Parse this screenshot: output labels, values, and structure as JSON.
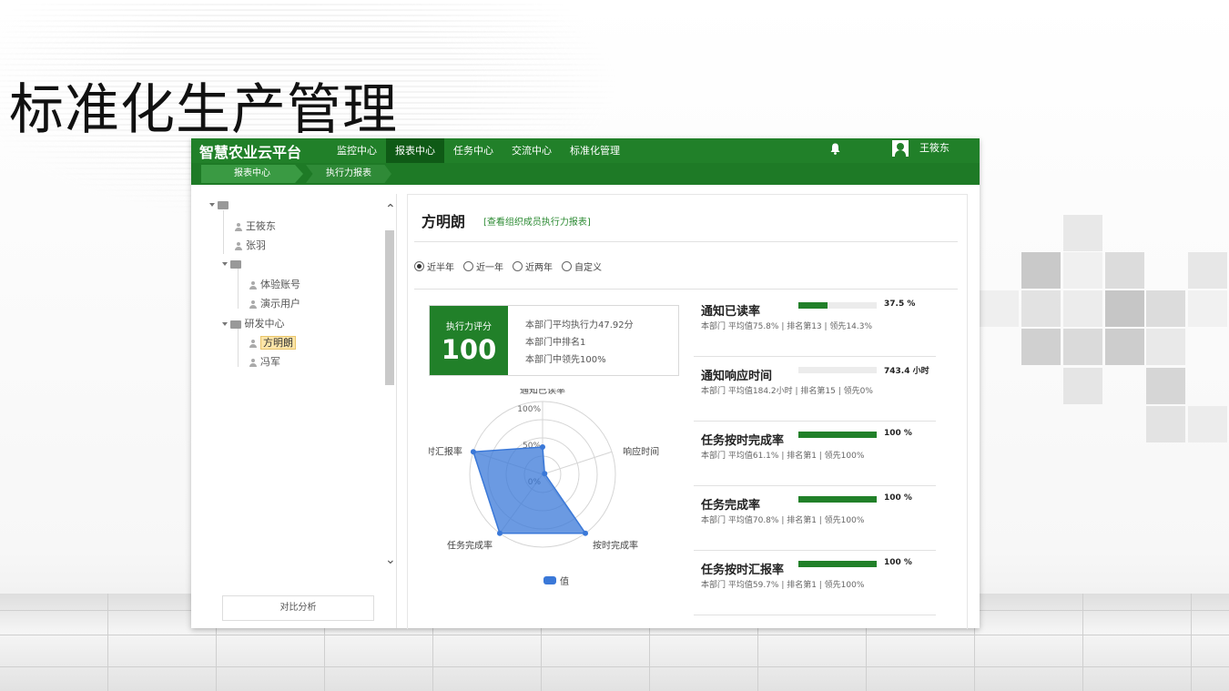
{
  "page_title": "标准化生产管理",
  "app": {
    "logo": "智慧农业云平台",
    "nav": [
      "监控中心",
      "报表中心",
      "任务中心",
      "交流中心",
      "标准化管理"
    ],
    "active_nav": "报表中心",
    "user_name": "王筱东",
    "icons": {
      "notifications": "bell-icon",
      "user": "user-avatar-icon"
    }
  },
  "breadcrumb": [
    "报表中心",
    "执行力报表"
  ],
  "tree": {
    "nodes": [
      {
        "label": "",
        "type": "folder",
        "expanded": true
      },
      {
        "label": "王筱东",
        "type": "person"
      },
      {
        "label": "张羽",
        "type": "person"
      },
      {
        "label": "",
        "type": "folder",
        "expanded": true
      },
      {
        "label": "体验账号",
        "type": "person"
      },
      {
        "label": "演示用户",
        "type": "person"
      },
      {
        "label": "研发中心",
        "type": "folder",
        "expanded": true
      },
      {
        "label": "方明朗",
        "type": "person",
        "selected": true
      },
      {
        "label": "冯军",
        "type": "person"
      }
    ],
    "compare_button": "对比分析"
  },
  "main": {
    "person_name": "方明朗",
    "view_link": "[查看组织成员执行力报表]",
    "periods": [
      "近半年",
      "近一年",
      "近两年",
      "自定义"
    ],
    "selected_period": "近半年",
    "score": {
      "label": "执行力评分",
      "value": "100",
      "lines": [
        "本部门平均执行力47.92分",
        "本部门中排名1",
        "本部门中领先100%"
      ]
    },
    "radar": {
      "axes": [
        "通知已读率",
        "响应时间",
        "按时完成率",
        "任务完成率",
        "按时汇报率"
      ],
      "ring_labels": [
        "100%",
        "50%",
        "0%"
      ],
      "legend": "值"
    },
    "metrics": [
      {
        "name": "通知已读率",
        "value": "37.5 %",
        "sub": "本部门 平均值75.8% | 排名第13 | 领先14.3%"
      },
      {
        "name": "通知响应时间",
        "value": "743.4 小时",
        "sub": "本部门 平均值184.2小时 | 排名第15 | 领先0%"
      },
      {
        "name": "任务按时完成率",
        "value": "100 %",
        "sub": "本部门 平均值61.1% | 排名第1 | 领先100%"
      },
      {
        "name": "任务完成率",
        "value": "100 %",
        "sub": "本部门 平均值70.8% | 排名第1 | 领先100%"
      },
      {
        "name": "任务按时汇报率",
        "value": "100 %",
        "sub": "本部门 平均值59.7% | 排名第1 | 领先100%"
      }
    ]
  },
  "chart_data": {
    "type": "radar",
    "axes": [
      "通知已读率",
      "响应时间",
      "按时完成率",
      "任务完成率",
      "按时汇报率"
    ],
    "range": [
      0,
      100
    ],
    "ring_labels": [
      "100%",
      "50%",
      "0%"
    ],
    "series": [
      {
        "name": "值",
        "values": [
          37.5,
          0,
          100,
          100,
          100
        ]
      }
    ],
    "legend": "bottom",
    "colors": {
      "fill": "#3a78d8",
      "grid": "#d5d5d5"
    }
  },
  "colors": {
    "brand": "#218029",
    "brand_dark": "#0f5a16",
    "accent_link": "#2b8a32",
    "radar": "#3a78d8"
  }
}
